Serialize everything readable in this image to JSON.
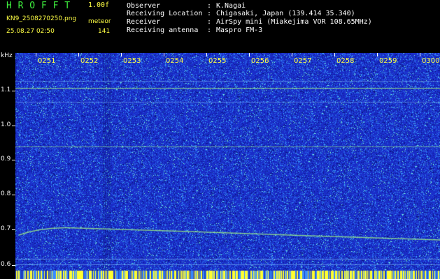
{
  "header": {
    "app_title": "H R O F F T",
    "version": "1.00f",
    "filename": "KN9_2508270250.png",
    "meteor_label": "meteor",
    "datetime": "25.08.27 02:50",
    "meteor_count": "141"
  },
  "info": [
    {
      "key": "Observer",
      "value": "K.Nagai"
    },
    {
      "key": "Receiving Location",
      "value": "Chigasaki, Japan (139.414 35.340)"
    },
    {
      "key": "Receiver",
      "value": "AirSpy mini (Miakejima VOR 108.65MHz)"
    },
    {
      "key": "Receiving antenna",
      "value": "Maspro FM-3"
    }
  ],
  "separator": ":",
  "axis": {
    "y_unit": "kHz",
    "y_ticks": [
      "1.1",
      "1.0",
      "0.9",
      "0.8",
      "0.7",
      "0.6"
    ],
    "x_ticks": [
      "0251",
      "0252",
      "0253",
      "0254",
      "0255",
      "0256",
      "0257",
      "0258",
      "0259",
      "0300"
    ]
  },
  "colors": {
    "background": "#1a2cc8",
    "noise_light": "#3aa8ff",
    "noise_hot": "#7fffd0",
    "signal": "#a8ff80",
    "meteor_bar": "#ffff30",
    "label_yellow": "#ffff44",
    "title_green": "#3ff23f"
  }
}
